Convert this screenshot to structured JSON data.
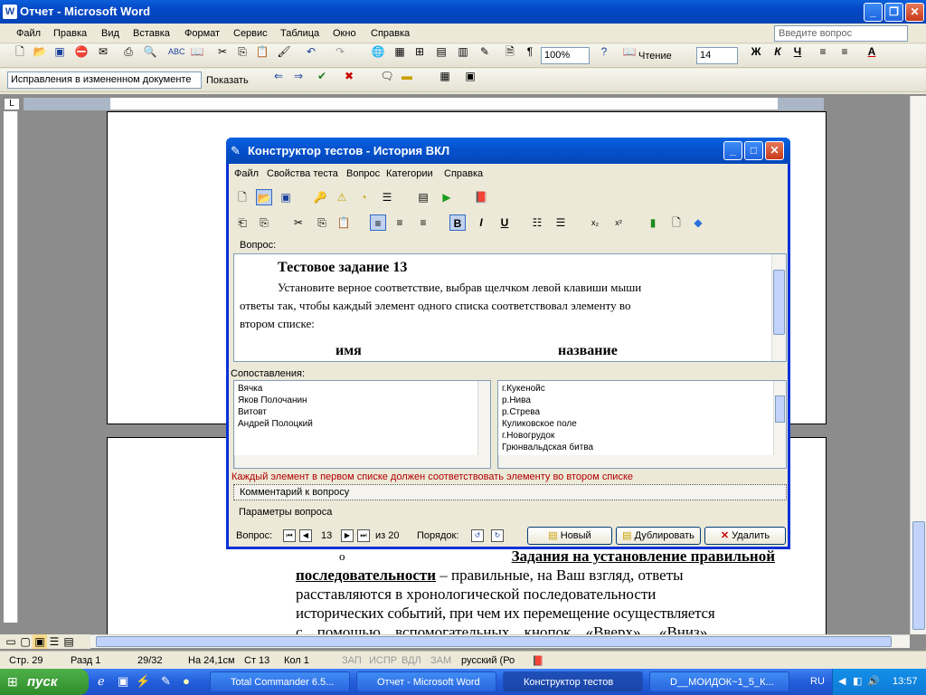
{
  "word": {
    "title": "Отчет - Microsoft Word",
    "menu": [
      "Файл",
      "Правка",
      "Вид",
      "Вставка",
      "Формат",
      "Сервис",
      "Таблица",
      "Окно",
      "Справка"
    ],
    "help_placeholder": "Введите вопрос",
    "zoom": "100%",
    "read_label": "Чтение",
    "font_size": "14",
    "bold": "Ж",
    "italic": "К",
    "underline": "Ч",
    "track_mode": "Исправления в измененном документе",
    "show_label": "Показать",
    "doc_text": {
      "line1_mark": "o",
      "line1": "Задания на установление правильной",
      "line2a": "последовательности",
      "line2b": " – правильные, на Ваш взгляд, ответы",
      "line3": "расставляются в хронологической последовательности",
      "line4": "исторических событий, при чем их перемещение осуществляется",
      "line5": "с помощью вспомогательных кнопок «Вверх», «Вниз»."
    },
    "status": {
      "page": "Стр. 29",
      "section": "Разд 1",
      "pages": "29/32",
      "at": "На 24,1см",
      "line": "Ст 13",
      "col": "Кол 1",
      "rec": "ЗАП",
      "trk": "ИСПР",
      "ext": "ВДЛ",
      "ovr": "ЗАМ",
      "lang": "русский (Ро"
    }
  },
  "dialog": {
    "title": "Конструктор тестов - История ВКЛ",
    "menu": [
      "Файл",
      "Свойства теста",
      "Вопрос",
      "Категории",
      "Справка"
    ],
    "question_label": "Вопрос:",
    "heading": "Тестовое задание 13",
    "para1": "Установите верное соответствие, выбрав щелчком левой клавиши мыши",
    "para2": "ответы так, чтобы каждый элемент одного списка соответствовал элементу во",
    "para3": "втором списке:",
    "col_left": "имя",
    "col_right": "название",
    "matches_label": "Сопоставления:",
    "left_list": [
      "Вячка",
      "Яков Полочанин",
      "Витовт",
      "Андрей Полоцкий"
    ],
    "right_list": [
      "г.Кукенойс",
      "р.Нива",
      "р.Стрева",
      "Куликовское поле",
      "г.Новогрудок",
      "Грюнвальдская битва"
    ],
    "hint": "Каждый элемент в первом списке должен соответствовать элементу во втором списке",
    "comment": "Комментарий к вопросу",
    "params": "Параметры вопроса",
    "nav_label": "Вопрос:",
    "nav_current": "13",
    "nav_of": "из 20",
    "order_label": "Порядок:",
    "btn_new": "Новый",
    "btn_dup": "Дублировать",
    "btn_del": "Удалить"
  },
  "taskbar": {
    "start": "пуск",
    "tasks": [
      "Total Commander 6.5...",
      "Отчет - Microsoft Word",
      "Конструктор тестов",
      "D__МОИДОК~1_5_К..."
    ],
    "lang": "RU",
    "time": "13:57"
  },
  "colors": {
    "xp_blue": "#0a5fd8",
    "hint_red": "#b00000",
    "dialog_bg": "#ece9d8"
  }
}
